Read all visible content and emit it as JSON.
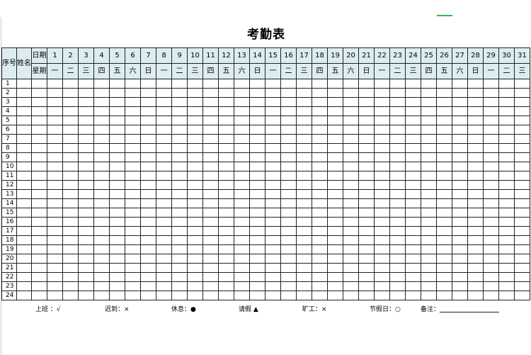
{
  "title": "考勤表",
  "header": {
    "index_label": "序号",
    "name_label": "姓名",
    "date_label": "日期",
    "weekday_label": "星期",
    "days": [
      "1",
      "2",
      "3",
      "4",
      "5",
      "6",
      "7",
      "8",
      "9",
      "10",
      "11",
      "12",
      "13",
      "14",
      "15",
      "16",
      "17",
      "18",
      "19",
      "20",
      "21",
      "22",
      "23",
      "24",
      "25",
      "26",
      "27",
      "28",
      "29",
      "30",
      "31"
    ],
    "weekdays": [
      "一",
      "二",
      "三",
      "四",
      "五",
      "六",
      "日",
      "一",
      "二",
      "三",
      "四",
      "五",
      "六",
      "日",
      "一",
      "二",
      "三",
      "四",
      "五",
      "六",
      "日",
      "一",
      "二",
      "三",
      "四",
      "五",
      "六",
      "日",
      "一",
      "二",
      "三"
    ]
  },
  "rows": [
    "1",
    "2",
    "3",
    "4",
    "5",
    "6",
    "7",
    "8",
    "9",
    "10",
    "11",
    "12",
    "13",
    "14",
    "15",
    "16",
    "17",
    "18",
    "19",
    "20",
    "21",
    "22",
    "23",
    "24"
  ],
  "legend": {
    "work": "上班 ：√",
    "late": "迟到：⨯",
    "rest": "休息：●",
    "leave": "请假 ▲",
    "absent": "旷工：×",
    "holiday": "节假日：○",
    "remark": "备注："
  }
}
